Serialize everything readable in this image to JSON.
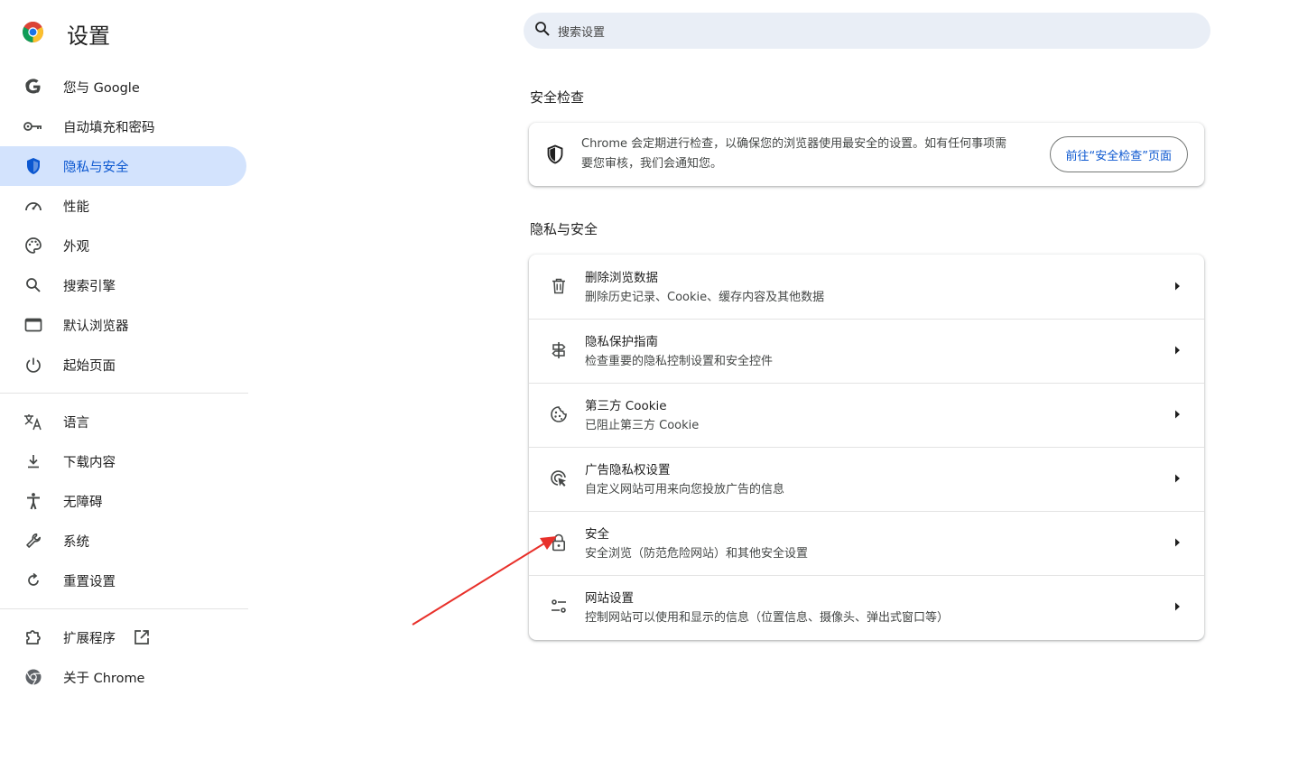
{
  "app_title": "设置",
  "search": {
    "placeholder": "搜索设置"
  },
  "nav": {
    "items": [
      {
        "label": "您与 Google",
        "icon": "google-g-icon"
      },
      {
        "label": "自动填充和密码",
        "icon": "key-icon"
      },
      {
        "label": "隐私与安全",
        "icon": "shield-icon",
        "active": true
      },
      {
        "label": "性能",
        "icon": "speedometer-icon"
      },
      {
        "label": "外观",
        "icon": "palette-icon"
      },
      {
        "label": "搜索引擎",
        "icon": "search-icon"
      },
      {
        "label": "默认浏览器",
        "icon": "browser-window-icon"
      },
      {
        "label": "起始页面",
        "icon": "power-icon"
      },
      {
        "label": "语言",
        "icon": "translate-icon"
      },
      {
        "label": "下载内容",
        "icon": "download-icon"
      },
      {
        "label": "无障碍",
        "icon": "accessibility-icon"
      },
      {
        "label": "系统",
        "icon": "wrench-icon"
      },
      {
        "label": "重置设置",
        "icon": "reset-icon"
      },
      {
        "label": "扩展程序",
        "icon": "puzzle-icon"
      },
      {
        "label": "关于 Chrome",
        "icon": "chrome-icon"
      }
    ]
  },
  "safety_check": {
    "title": "安全检查",
    "description": "Chrome 会定期进行检查，以确保您的浏览器使用最安全的设置。如有任何事项需要您审核，我们会通知您。",
    "button_label": "前往“安全检查”页面"
  },
  "privacy": {
    "title": "隐私与安全",
    "rows": [
      {
        "title": "删除浏览数据",
        "subtitle": "删除历史记录、Cookie、缓存内容及其他数据",
        "icon": "trash-icon"
      },
      {
        "title": "隐私保护指南",
        "subtitle": "检查重要的隐私控制设置和安全控件",
        "icon": "signpost-icon"
      },
      {
        "title": "第三方 Cookie",
        "subtitle": "已阻止第三方 Cookie",
        "icon": "cookie-icon"
      },
      {
        "title": "广告隐私权设置",
        "subtitle": "自定义网站可用来向您投放广告的信息",
        "icon": "ad-privacy-icon"
      },
      {
        "title": "安全",
        "subtitle": "安全浏览（防范危险网站）和其他安全设置",
        "icon": "lock-icon"
      },
      {
        "title": "网站设置",
        "subtitle": "控制网站可以使用和显示的信息（位置信息、摄像头、弹出式窗口等）",
        "icon": "tune-icon"
      }
    ]
  },
  "colors": {
    "accent": "#0b57d0",
    "active_bg": "#d3e3fd",
    "search_bg": "#e9eef6",
    "annotation_arrow": "#e8302a"
  }
}
